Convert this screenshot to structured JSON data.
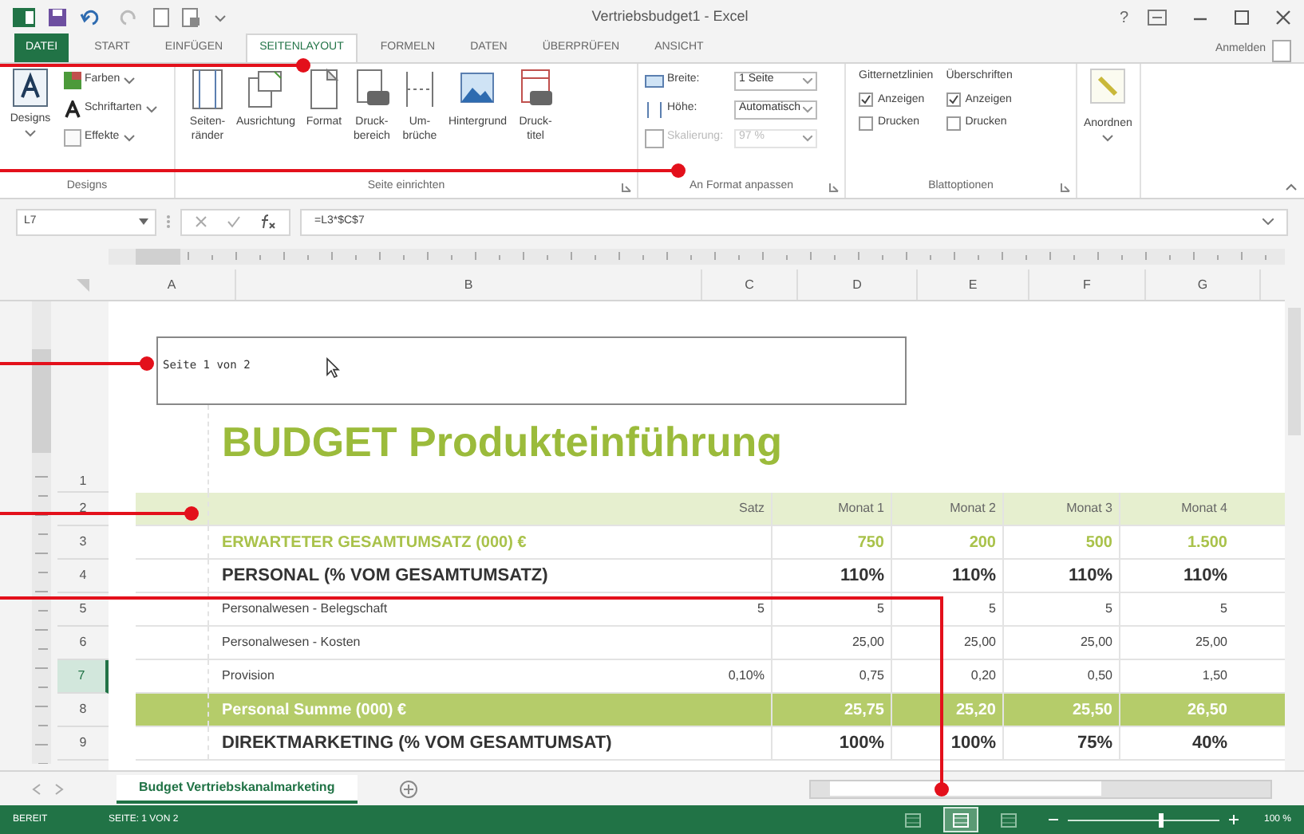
{
  "window": {
    "title": "Vertriebsbudget1 - Excel",
    "help": "?",
    "sign_in": "Anmelden"
  },
  "tabs": [
    {
      "label": "DATEI",
      "selected": false,
      "kind": "file"
    },
    {
      "label": "START",
      "selected": false,
      "kind": "tab"
    },
    {
      "label": "EINFÜGEN",
      "selected": false,
      "kind": "tab"
    },
    {
      "label": "SEITENLAYOUT",
      "selected": true,
      "kind": "tab"
    },
    {
      "label": "FORMELN",
      "selected": false,
      "kind": "tab"
    },
    {
      "label": "DATEN",
      "selected": false,
      "kind": "tab"
    },
    {
      "label": "ÜBERPRÜFEN",
      "selected": false,
      "kind": "tab"
    },
    {
      "label": "ANSICHT",
      "selected": false,
      "kind": "tab"
    }
  ],
  "ribbon": {
    "designs": {
      "label": "Designs",
      "button": "Designs",
      "items": [
        "Farben",
        "Schriftarten",
        "Effekte"
      ]
    },
    "page_setup": {
      "label": "Seite einrichten",
      "buttons": [
        {
          "lines": [
            "Seiten-",
            "ränder"
          ]
        },
        {
          "lines": [
            "Ausrichtung"
          ]
        },
        {
          "lines": [
            "Format"
          ]
        },
        {
          "lines": [
            "Druck-",
            "bereich"
          ]
        },
        {
          "lines": [
            "Um-",
            "brüche"
          ]
        },
        {
          "lines": [
            "Hintergrund"
          ]
        },
        {
          "lines": [
            "Druck-",
            "titel"
          ]
        }
      ]
    },
    "fit": {
      "label": "An Format anpassen",
      "rows": [
        {
          "label": "Breite:",
          "value": "1 Seite",
          "disabled": false
        },
        {
          "label": "Höhe:",
          "value": "Automatisch",
          "disabled": false
        },
        {
          "label": "Skalierung:",
          "value": "97 %",
          "disabled": true
        }
      ]
    },
    "sheet_options": {
      "label": "Blattoptionen",
      "columns": [
        {
          "heading": "Gitternetzlinien",
          "options": [
            {
              "label": "Anzeigen",
              "checked": true
            },
            {
              "label": "Drucken",
              "checked": false
            }
          ]
        },
        {
          "heading": "Überschriften",
          "options": [
            {
              "label": "Anzeigen",
              "checked": true
            },
            {
              "label": "Drucken",
              "checked": false
            }
          ]
        }
      ]
    },
    "arrange": {
      "label": "Anordnen"
    }
  },
  "formula_bar": {
    "name_box": "L7",
    "formula": "=L3*$C$7"
  },
  "columns": [
    "A",
    "B",
    "C",
    "D",
    "E",
    "F",
    "G"
  ],
  "page_header": "Seite 1 von 2",
  "title": "BUDGET Produkteinführung",
  "rows": [
    {
      "number": "1",
      "kind": "title",
      "selected": false
    },
    {
      "number": "2",
      "kind": "header",
      "selected": false,
      "rate": "Satz",
      "values": [
        "Monat 1",
        "Monat 2",
        "Monat 3",
        "Monat 4"
      ]
    },
    {
      "number": "3",
      "kind": "revenue",
      "selected": false,
      "label": "ERWARTETER GESAMTUMSATZ (000) €",
      "values": [
        "750",
        "200",
        "500",
        "1.500"
      ]
    },
    {
      "number": "4",
      "kind": "section",
      "selected": false,
      "label": "PERSONAL (% VOM GESAMTUMSATZ)",
      "values": [
        "110%",
        "110%",
        "110%",
        "110%"
      ]
    },
    {
      "number": "5",
      "kind": "item",
      "selected": false,
      "label": "Personalwesen - Belegschaft",
      "rate": "5",
      "values": [
        "5",
        "5",
        "5",
        "5"
      ]
    },
    {
      "number": "6",
      "kind": "item",
      "selected": false,
      "label": "Personalwesen - Kosten",
      "values": [
        "25,00",
        "25,00",
        "25,00",
        "25,00"
      ]
    },
    {
      "number": "7",
      "kind": "item",
      "selected": true,
      "label": "Provision",
      "rate": "0,10%",
      "values": [
        "0,75",
        "0,20",
        "0,50",
        "1,50"
      ]
    },
    {
      "number": "8",
      "kind": "total",
      "selected": false,
      "label": "Personal Summe (000) €",
      "values": [
        "25,75",
        "25,20",
        "25,50",
        "26,50"
      ]
    },
    {
      "number": "9",
      "kind": "section",
      "selected": false,
      "label": "DIREKTMARKETING (% VOM GESAMTUMSAT)",
      "values": [
        "100%",
        "100%",
        "75%",
        "40%"
      ]
    }
  ],
  "sheet_tabs": [
    {
      "label": "Budget Vertriebskanalmarketing",
      "selected": true
    }
  ],
  "status_bar": {
    "mode": "BEREIT",
    "page": "SEITE: 1 VON 2",
    "views": [
      {
        "selected": false
      },
      {
        "selected": true
      },
      {
        "selected": false
      }
    ],
    "zoom": {
      "level": 0.6
    },
    "zoom_label": "100 %"
  }
}
